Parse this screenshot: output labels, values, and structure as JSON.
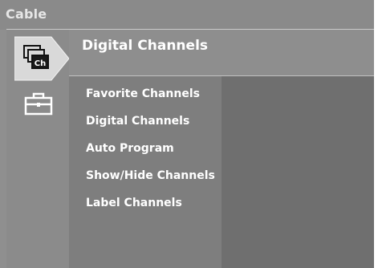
{
  "window": {
    "title": "Cable"
  },
  "header": {
    "title": "Digital Channels"
  },
  "menu": {
    "items": [
      {
        "label": "Favorite Channels"
      },
      {
        "label": "Digital Channels"
      },
      {
        "label": "Auto Program"
      },
      {
        "label": "Show/Hide Channels"
      },
      {
        "label": "Label Channels"
      }
    ]
  },
  "icons": {
    "selected_tab": "channels-icon",
    "secondary_tab": "toolbox-icon",
    "channels_icon_text": "Ch"
  },
  "colors": {
    "background": "#8f8f8f",
    "menu_panel": "#7e7e7e",
    "content_panel": "#6f6f6f",
    "text": "#ffffff"
  }
}
